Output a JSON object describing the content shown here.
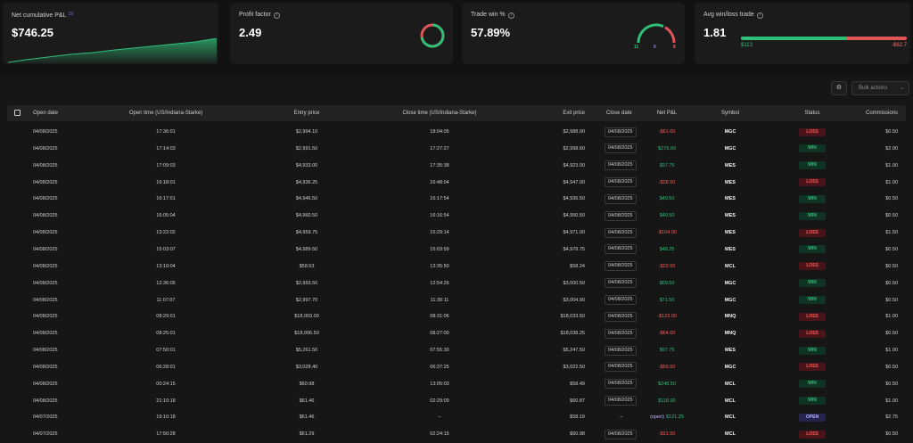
{
  "cards": {
    "net_pnl": {
      "title": "Net cumulative P&L",
      "badge": "19",
      "value": "$746.25"
    },
    "profit_factor": {
      "title": "Profit factor",
      "value": "2.49"
    },
    "trade_win": {
      "title": "Trade win %",
      "value": "57.89%",
      "wins": "11",
      "breakeven": "0",
      "losses": "8"
    },
    "avg_win_loss": {
      "title": "Avg win/loss trade",
      "value": "1.81",
      "avg_win": "$113",
      "avg_loss": "-$62.7"
    }
  },
  "colors": {
    "win": "#2fbf78",
    "loss": "#ff5a5a",
    "open": "#b9b4ff"
  },
  "toolbar": {
    "settings_icon": "settings-icon",
    "bulk_actions": "Bulk actions"
  },
  "columns": {
    "open_date": "Open date",
    "open_time": "Open time (US/Indiana-Starke)",
    "entry_price": "Entry price",
    "close_time": "Close time (US/Indiana-Starke)",
    "exit_price": "Exit price",
    "close_date": "Close date",
    "net_pnl": "Net P&L",
    "symbol": "Symbol",
    "status": "Status",
    "commissions": "Commissions"
  },
  "rows": [
    {
      "open_date": "04/08/2025",
      "open_time": "17:36:01",
      "entry": "$2,994.10",
      "close_time": "18:04:05",
      "exit": "$2,988.00",
      "close_date": "04/08/2025",
      "pnl": "-$61.00",
      "symbol": "MGC",
      "status": "LOSS",
      "comm": "$0.50"
    },
    {
      "open_date": "04/08/2025",
      "open_time": "17:14:03",
      "entry": "$2,991.50",
      "close_time": "17:27:27",
      "exit": "$2,998.60",
      "close_date": "04/08/2025",
      "pnl": "$276.00",
      "symbol": "MGC",
      "status": "WIN",
      "comm": "$2.00"
    },
    {
      "open_date": "04/08/2025",
      "open_time": "17:09:03",
      "entry": "$4,933.00",
      "close_time": "17:35:38",
      "exit": "$4,923.00",
      "close_date": "04/08/2025",
      "pnl": "$97.75",
      "symbol": "MES",
      "status": "WIN",
      "comm": "$1.00"
    },
    {
      "open_date": "04/08/2025",
      "open_time": "16:18:01",
      "entry": "$4,936.25",
      "close_time": "16:48:04",
      "exit": "$4,947.00",
      "close_date": "04/08/2025",
      "pnl": "-$28.50",
      "symbol": "MES",
      "status": "LOSS",
      "comm": "$1.00"
    },
    {
      "open_date": "04/08/2025",
      "open_time": "16:17:01",
      "entry": "$4,946.50",
      "close_time": "16:17:54",
      "exit": "$4,936.50",
      "close_date": "04/08/2025",
      "pnl": "$49.50",
      "symbol": "MES",
      "status": "WIN",
      "comm": "$0.50"
    },
    {
      "open_date": "04/08/2025",
      "open_time": "16:05:04",
      "entry": "$4,960.50",
      "close_time": "16:16:54",
      "exit": "$4,950.50",
      "close_date": "04/08/2025",
      "pnl": "$49.50",
      "symbol": "MES",
      "status": "WIN",
      "comm": "$0.50"
    },
    {
      "open_date": "04/08/2025",
      "open_time": "13:22:02",
      "entry": "$4,959.75",
      "close_time": "15:29:14",
      "exit": "$4,971.00",
      "close_date": "04/08/2025",
      "pnl": "-$104.00",
      "symbol": "MES",
      "status": "LOSS",
      "comm": "$1.50"
    },
    {
      "open_date": "04/08/2025",
      "open_time": "15:03:07",
      "entry": "$4,989.50",
      "close_time": "15:03:59",
      "exit": "$4,979.75",
      "close_date": "04/08/2025",
      "pnl": "$48.25",
      "symbol": "MES",
      "status": "WIN",
      "comm": "$0.50"
    },
    {
      "open_date": "04/08/2025",
      "open_time": "13:10:04",
      "entry": "$58.53",
      "close_time": "13:35:50",
      "exit": "$58.24",
      "close_date": "04/08/2025",
      "pnl": "-$29.50",
      "symbol": "MCL",
      "status": "LOSS",
      "comm": "$0.50"
    },
    {
      "open_date": "04/08/2025",
      "open_time": "12:36:05",
      "entry": "$2,993.50",
      "close_time": "12:54:26",
      "exit": "$3,000.50",
      "close_date": "04/08/2025",
      "pnl": "$69.50",
      "symbol": "MGC",
      "status": "WIN",
      "comm": "$0.50"
    },
    {
      "open_date": "04/08/2025",
      "open_time": "11:07:07",
      "entry": "$2,997.70",
      "close_time": "11:30:11",
      "exit": "$3,004.90",
      "close_date": "04/08/2025",
      "pnl": "$71.50",
      "symbol": "MGC",
      "status": "WIN",
      "comm": "$0.50"
    },
    {
      "open_date": "04/08/2025",
      "open_time": "08:29:01",
      "entry": "$18,003.00",
      "close_time": "08:31:06",
      "exit": "$18,033.50",
      "close_date": "04/08/2025",
      "pnl": "-$123.00",
      "symbol": "MNQ",
      "status": "LOSS",
      "comm": "$1.00"
    },
    {
      "open_date": "04/08/2025",
      "open_time": "08:25:01",
      "entry": "$18,006.50",
      "close_time": "08:27:00",
      "exit": "$18,038.25",
      "close_date": "04/08/2025",
      "pnl": "-$64.00",
      "symbol": "MNQ",
      "status": "LOSS",
      "comm": "$0.50"
    },
    {
      "open_date": "04/08/2025",
      "open_time": "07:50:01",
      "entry": "$5,261.50",
      "close_time": "07:55:30",
      "exit": "$5,247.50",
      "close_date": "04/08/2025",
      "pnl": "$97.75",
      "symbol": "MES",
      "status": "WIN",
      "comm": "$1.00"
    },
    {
      "open_date": "04/08/2025",
      "open_time": "06:28:01",
      "entry": "$3,028.40",
      "close_time": "06:37:25",
      "exit": "$3,022.50",
      "close_date": "04/08/2025",
      "pnl": "-$59.50",
      "symbol": "MGC",
      "status": "LOSS",
      "comm": "$0.50"
    },
    {
      "open_date": "04/08/2025",
      "open_time": "00:24:15",
      "entry": "$60.98",
      "close_time": "13:05:03",
      "exit": "$58.49",
      "close_date": "04/08/2025",
      "pnl": "$248.50",
      "symbol": "MCL",
      "status": "WIN",
      "comm": "$0.50"
    },
    {
      "open_date": "04/08/2025",
      "open_time": "21:10:18",
      "entry": "$61.46",
      "close_time": "02:29:09",
      "exit": "$60.87",
      "close_date": "04/08/2025",
      "pnl": "$118.00",
      "symbol": "MCL",
      "status": "WIN",
      "comm": "$1.00"
    },
    {
      "open_date": "04/07/2025",
      "open_time": "19:10:18",
      "entry": "$61.46",
      "close_time": "–",
      "exit": "$58.19",
      "close_date": "–",
      "pnl_tag": "(open)",
      "pnl": "$121.25",
      "symbol": "MCL",
      "status": "OPEN",
      "comm": "$2.75"
    },
    {
      "open_date": "04/07/2025",
      "open_time": "17:50:28",
      "entry": "$61.29",
      "close_time": "02:24:15",
      "exit": "$60.98",
      "close_date": "04/08/2025",
      "pnl": "-$31.50",
      "symbol": "MCL",
      "status": "LOSS",
      "comm": "$0.50"
    }
  ]
}
